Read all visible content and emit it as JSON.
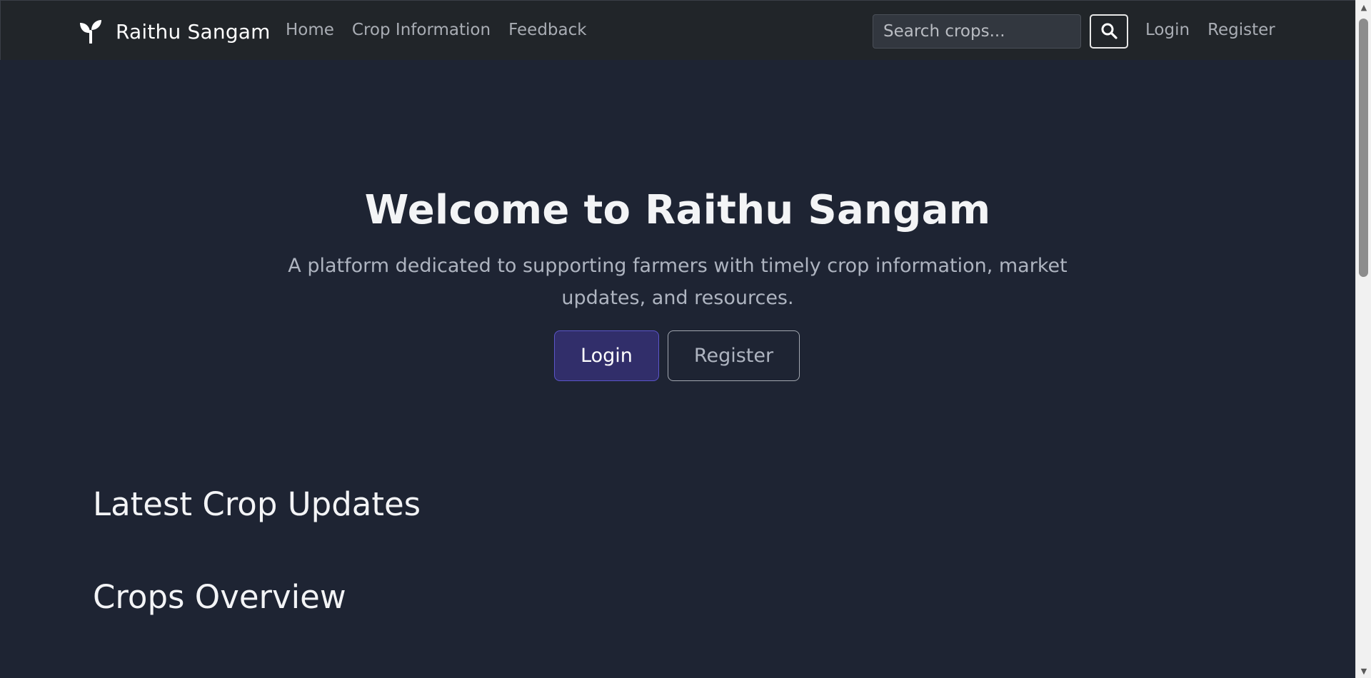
{
  "navbar": {
    "brand": "Raithu Sangam",
    "brand_icon": "seedling-icon",
    "links": [
      "Home",
      "Crop Information",
      "Feedback"
    ],
    "search_placeholder": "Search crops...",
    "search_icon": "search-icon",
    "login": "Login",
    "register": "Register"
  },
  "hero": {
    "title": "Welcome to Raithu Sangam",
    "subtitle_line1": "A platform dedicated to supporting farmers with timely crop information, market",
    "subtitle_line2": "updates, and resources.",
    "login_button": "Login",
    "register_button": "Register"
  },
  "sections": {
    "latest_updates": "Latest Crop Updates",
    "crops_overview": "Crops Overview"
  },
  "colors": {
    "page_background": "#1e2433",
    "navbar_background": "#212529",
    "primary_button": "#312e6a",
    "primary_border": "#5b55c9"
  }
}
